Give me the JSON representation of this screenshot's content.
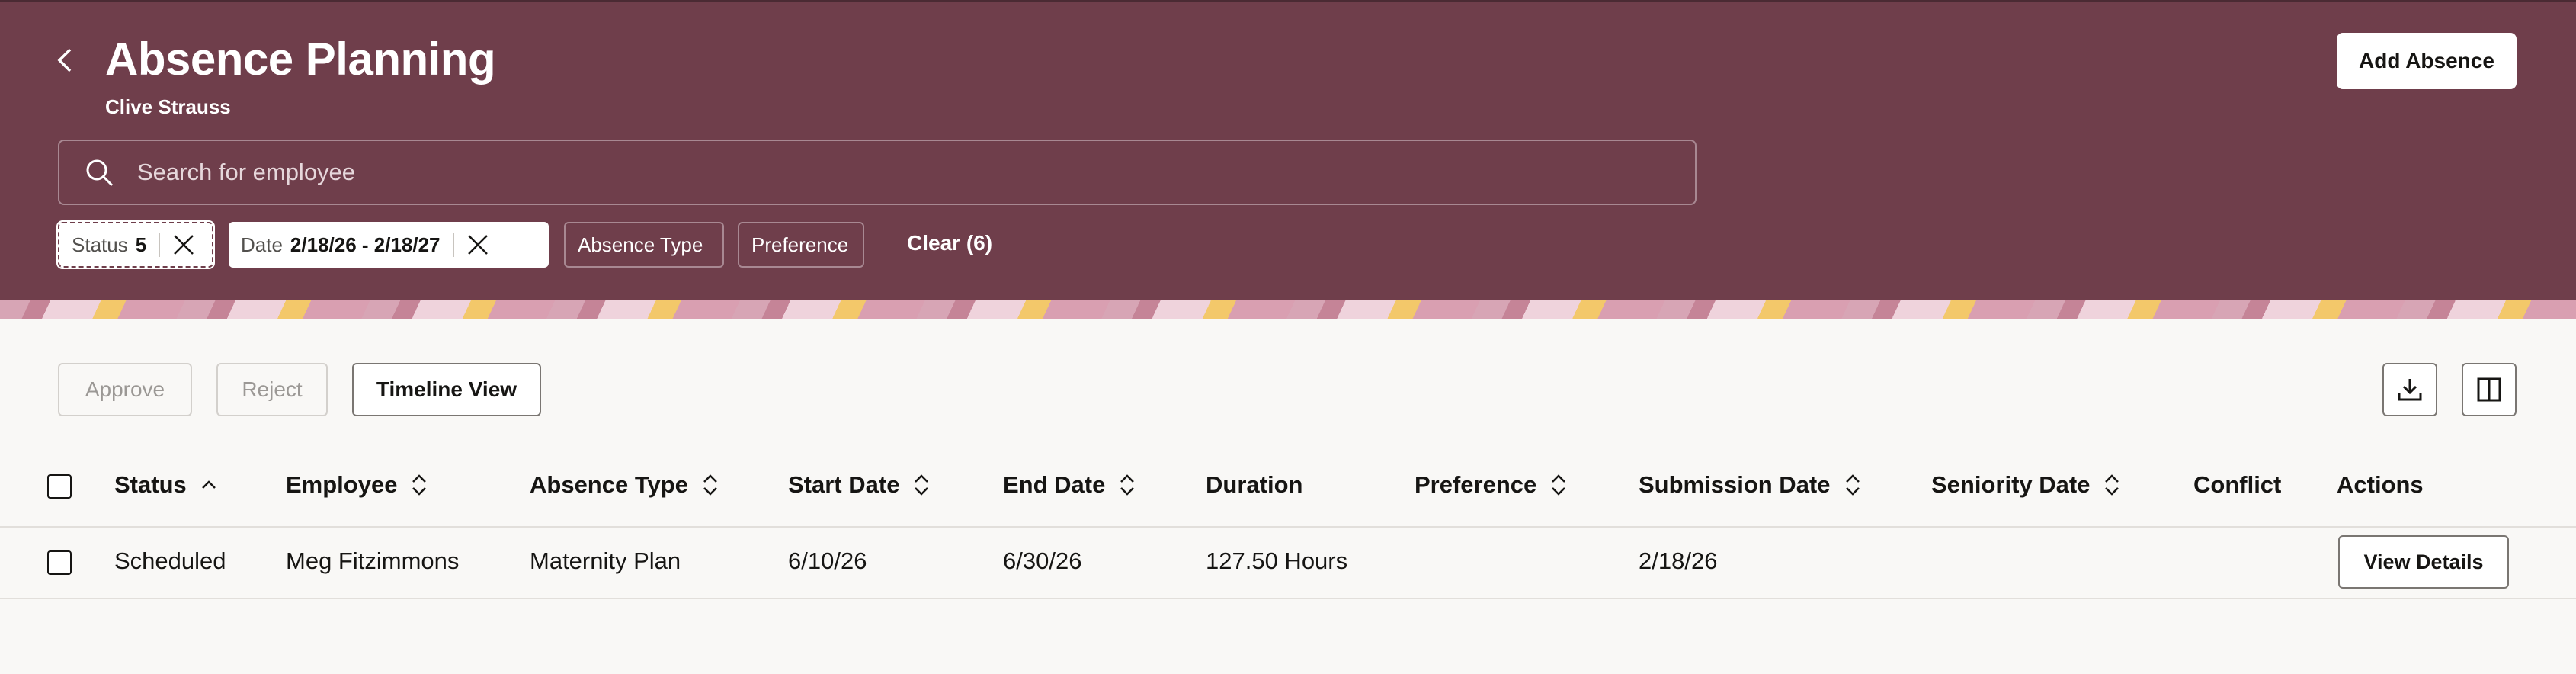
{
  "header": {
    "title": "Absence Planning",
    "subtitle": "Clive Strauss",
    "add_button": "Add Absence",
    "back_icon": "chevron-left-icon"
  },
  "search": {
    "placeholder": "Search for employee",
    "icon": "search-icon"
  },
  "filters": {
    "status": {
      "label": "Status",
      "value": "5"
    },
    "date": {
      "label": "Date",
      "value": "2/18/26 - 2/18/27"
    },
    "absence_type": "Absence Type",
    "preference": "Preference",
    "clear": "Clear (6)"
  },
  "toolbar": {
    "approve": "Approve",
    "reject": "Reject",
    "timeline": "Timeline View",
    "download_icon": "download-icon",
    "columns_icon": "columns-icon"
  },
  "table": {
    "columns": [
      "Status",
      "Employee",
      "Absence Type",
      "Start Date",
      "End Date",
      "Duration",
      "Preference",
      "Submission Date",
      "Seniority Date",
      "Conflict",
      "Actions"
    ],
    "rows": [
      {
        "status": "Scheduled",
        "employee": "Meg Fitzimmons",
        "absence_type": "Maternity Plan",
        "start_date": "6/10/26",
        "end_date": "6/30/26",
        "duration": "127.50 Hours",
        "preference": "",
        "submission_date": "2/18/26",
        "seniority_date": "",
        "conflict": "",
        "action": "View Details"
      }
    ]
  },
  "colors": {
    "header_bg": "#6f3e4b",
    "page_bg": "#f9f8f6"
  }
}
